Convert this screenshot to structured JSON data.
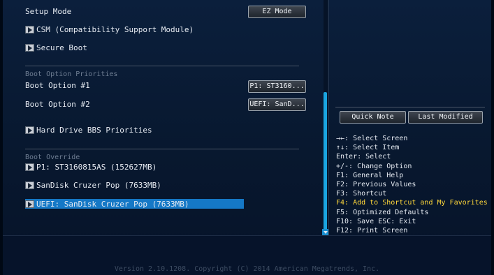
{
  "setup_mode": {
    "label": "Setup Mode",
    "button": "EZ Mode"
  },
  "submenus_top": [
    "CSM (Compatibility Support Module)",
    "Secure Boot"
  ],
  "boot_priorities": {
    "header": "Boot Option Priorities",
    "options": [
      {
        "label": "Boot Option #1",
        "value": "P1: ST3160..."
      },
      {
        "label": "Boot Option #2",
        "value": "UEFI: SanD..."
      }
    ],
    "hdd_bbs": "Hard Drive BBS Priorities"
  },
  "boot_override": {
    "header": "Boot Override",
    "items": [
      "P1: ST3160815AS  (152627MB)",
      "SanDisk Cruzer Pop  (7633MB)",
      "UEFI: SanDisk Cruzer Pop (7633MB)"
    ]
  },
  "right": {
    "quick_note": "Quick Note",
    "last_modified": "Last Modified",
    "help": [
      "→←: Select Screen",
      "↑↓: Select Item",
      "Enter: Select",
      "+/-: Change Option",
      "F1: General Help",
      "F2: Previous Values",
      "F3: Shortcut",
      "F4: Add to Shortcut and My Favorites",
      "F5: Optimized Defaults",
      "F10: Save  ESC: Exit",
      "F12: Print Screen"
    ]
  },
  "version": "Version 2.10.1208. Copyright (C) 2014 American Megatrends, Inc.",
  "colors": {
    "selection": "#1578c6",
    "highlight_help": "#ffd83a",
    "scrollbar": "#1aa5e0"
  }
}
